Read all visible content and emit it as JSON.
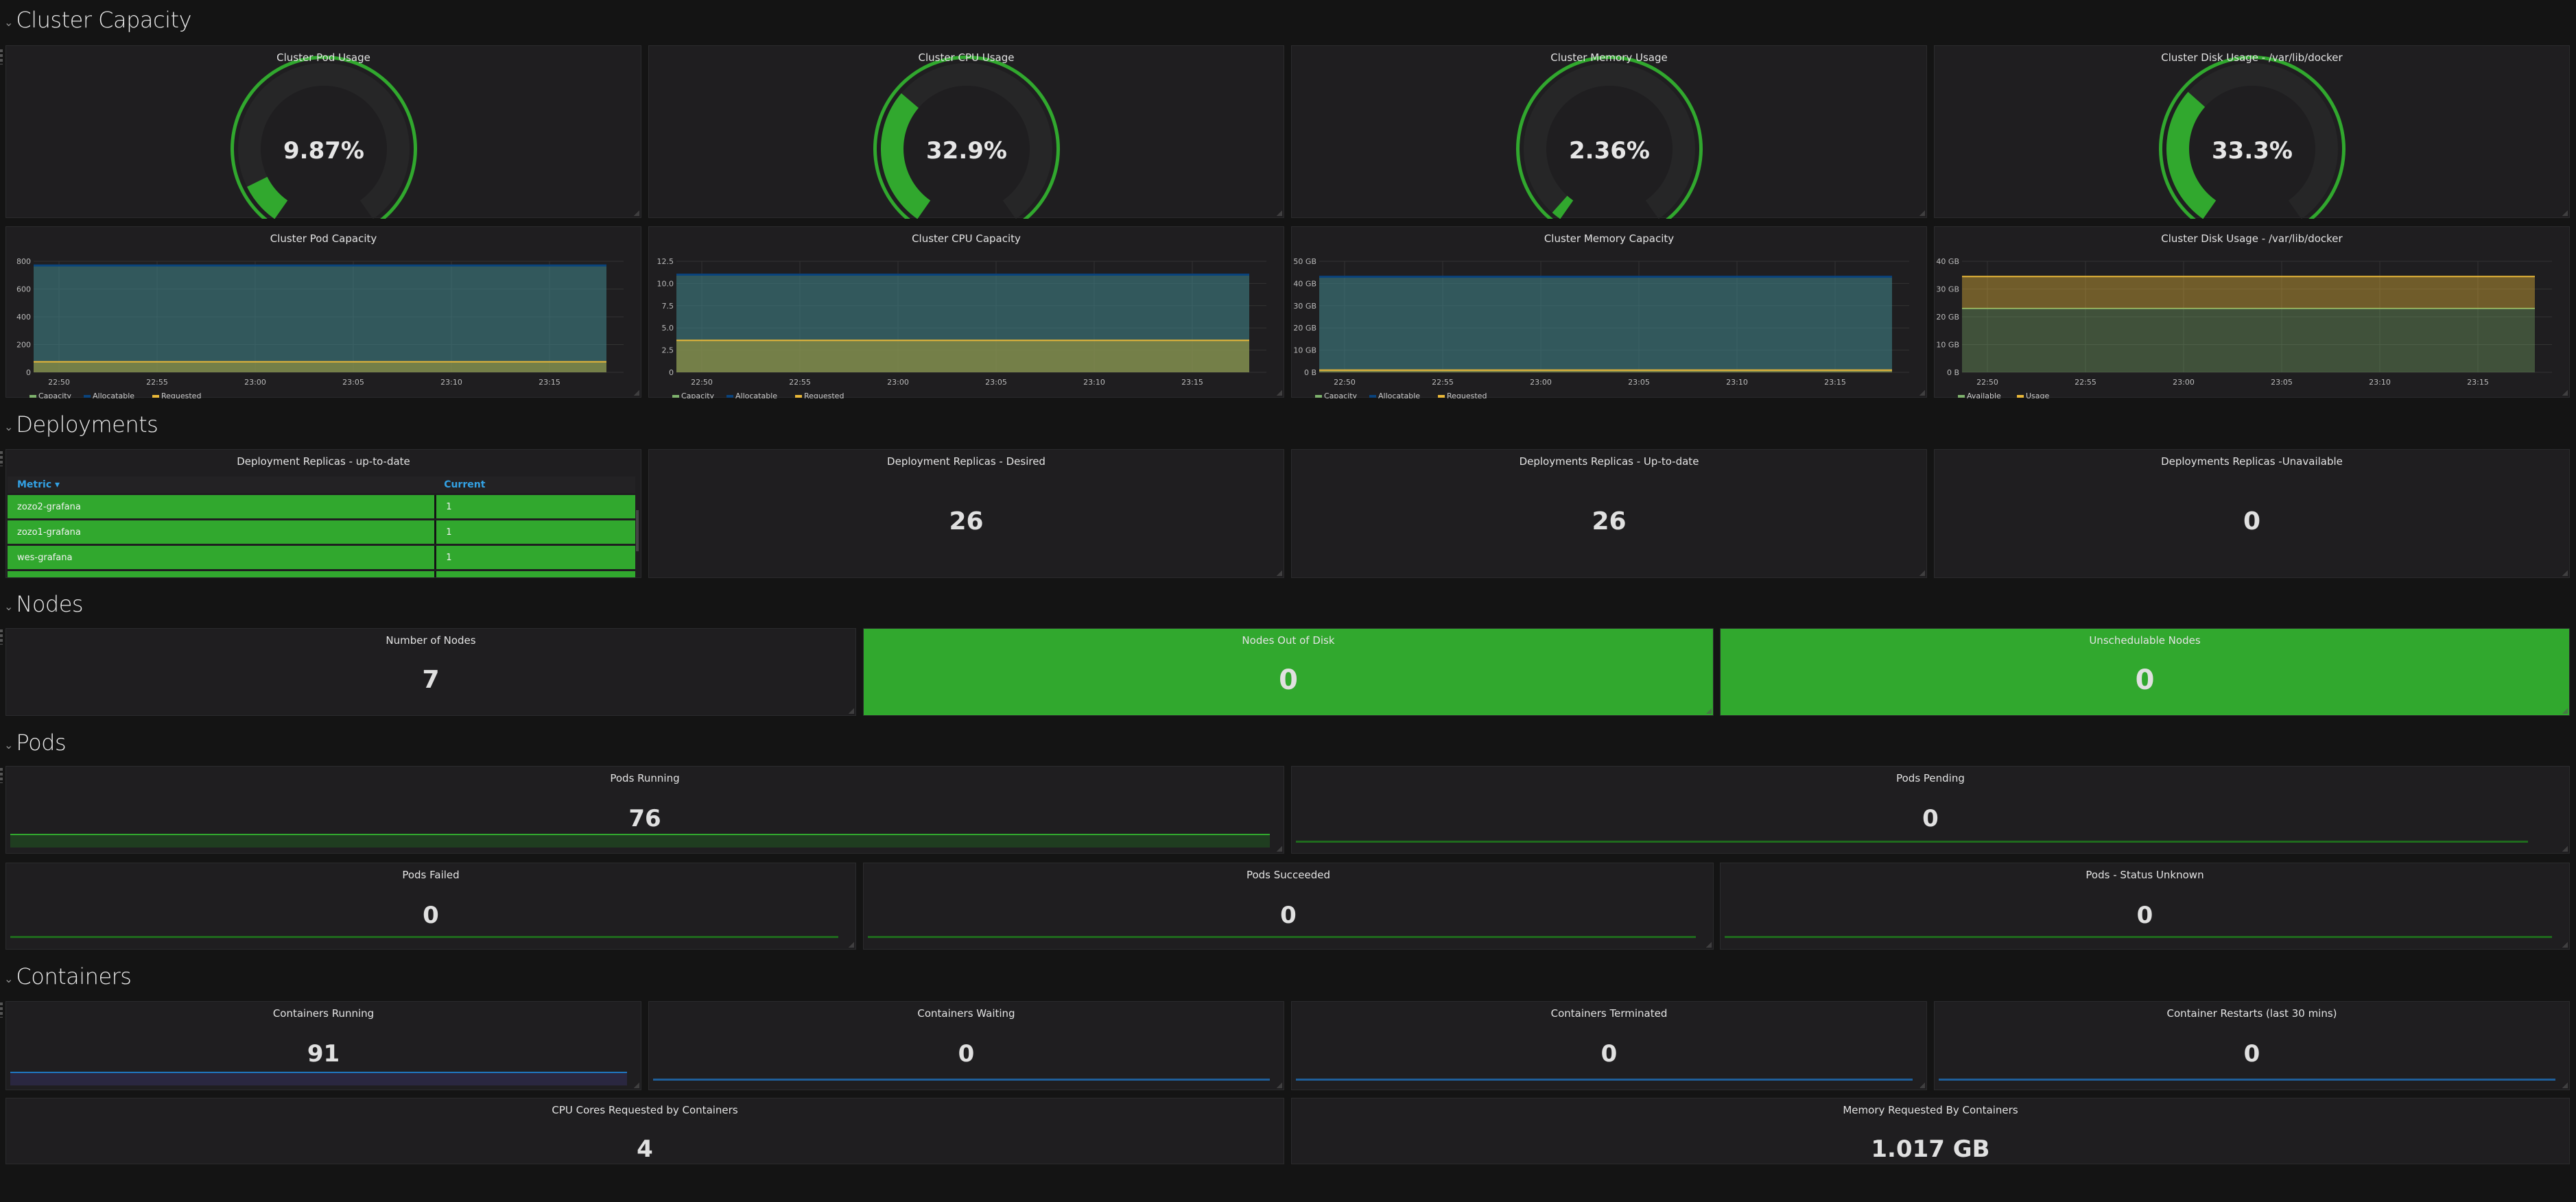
{
  "rows": {
    "cluster_capacity": "Cluster Capacity",
    "deployments": "Deployments",
    "nodes": "Nodes",
    "pods": "Pods",
    "containers": "Containers"
  },
  "colors": {
    "ok_green": "#31a82e",
    "capacity": "#7eb26d",
    "allocatable": "#0a437c",
    "requested": "#eab839",
    "blue_line": "#1f78c1"
  },
  "gauges": [
    {
      "title": "Cluster Pod Usage",
      "value_label": "9.87%",
      "percent": 9.87
    },
    {
      "title": "Cluster CPU Usage",
      "value_label": "32.9%",
      "percent": 32.9
    },
    {
      "title": "Cluster Memory Usage",
      "value_label": "2.36%",
      "percent": 2.36
    },
    {
      "title": "Cluster Disk Usage - /var/lib/docker",
      "value_label": "33.3%",
      "percent": 33.3
    }
  ],
  "chart_data": [
    {
      "type": "area",
      "title": "Cluster Pod Capacity",
      "x": [
        "22:50",
        "22:55",
        "23:00",
        "23:05",
        "23:10",
        "23:15"
      ],
      "yticks": [
        "0",
        "200",
        "400",
        "600",
        "800"
      ],
      "ylim": [
        0,
        800
      ],
      "grid": true,
      "legend": "bottom-left",
      "series": [
        {
          "name": "Capacity",
          "color": "#7eb26d",
          "value": 770
        },
        {
          "name": "Allocatable",
          "color": "#0a437c",
          "value": 770
        },
        {
          "name": "Requested",
          "color": "#eab839",
          "value": 76
        }
      ]
    },
    {
      "type": "area",
      "title": "Cluster CPU Capacity",
      "x": [
        "22:50",
        "22:55",
        "23:00",
        "23:05",
        "23:10",
        "23:15"
      ],
      "yticks": [
        "0",
        "2.5",
        "5.0",
        "7.5",
        "10.0",
        "12.5"
      ],
      "ylim": [
        0,
        12.5
      ],
      "grid": true,
      "legend": "bottom-left",
      "series": [
        {
          "name": "Capacity",
          "color": "#7eb26d",
          "value": 11
        },
        {
          "name": "Allocatable",
          "color": "#0a437c",
          "value": 11
        },
        {
          "name": "Requested",
          "color": "#eab839",
          "value": 3.6
        }
      ]
    },
    {
      "type": "area",
      "title": "Cluster Memory Capacity",
      "x": [
        "22:50",
        "22:55",
        "23:00",
        "23:05",
        "23:10",
        "23:15"
      ],
      "yticks": [
        "0 B",
        "10 GB",
        "20 GB",
        "30 GB",
        "40 GB",
        "50 GB"
      ],
      "ylim": [
        0,
        50
      ],
      "grid": true,
      "legend": "bottom-left",
      "series": [
        {
          "name": "Capacity",
          "color": "#7eb26d",
          "value": 43
        },
        {
          "name": "Allocatable",
          "color": "#0a437c",
          "value": 43
        },
        {
          "name": "Requested",
          "color": "#eab839",
          "value": 1.0
        }
      ]
    },
    {
      "type": "area",
      "title": "Cluster Disk Usage - /var/lib/docker",
      "x": [
        "22:50",
        "22:55",
        "23:00",
        "23:05",
        "23:10",
        "23:15"
      ],
      "yticks": [
        "0 B",
        "10 GB",
        "20 GB",
        "30 GB",
        "40 GB"
      ],
      "ylim": [
        0,
        40
      ],
      "grid": true,
      "legend": "bottom-left",
      "stacked": true,
      "series": [
        {
          "name": "Available",
          "color": "#7eb26d",
          "value": 23
        },
        {
          "name": "Usage",
          "color": "#eab839",
          "value": 11.5
        }
      ]
    }
  ],
  "deployments": {
    "table": {
      "title": "Deployment Replicas - up-to-date",
      "columns": [
        "Metric",
        "Current"
      ],
      "rows": [
        [
          "zozo2-grafana",
          "1"
        ],
        [
          "zozo1-grafana",
          "1"
        ],
        [
          "wes-grafana",
          "1"
        ],
        [
          "",
          ""
        ]
      ]
    },
    "stats": [
      {
        "title": "Deployment Replicas - Desired",
        "value": "26"
      },
      {
        "title": "Deployments Replicas - Up-to-date",
        "value": "26"
      },
      {
        "title": "Deployments Replicas -Unavailable",
        "value": "0"
      }
    ]
  },
  "nodes": [
    {
      "title": "Number of Nodes",
      "value": "7"
    },
    {
      "title": "Nodes Out of Disk",
      "value": "0"
    },
    {
      "title": "Unschedulable Nodes",
      "value": "0"
    }
  ],
  "pods": [
    {
      "title": "Pods Running",
      "value": "76"
    },
    {
      "title": "Pods Pending",
      "value": "0"
    },
    {
      "title": "Pods Failed",
      "value": "0"
    },
    {
      "title": "Pods Succeeded",
      "value": "0"
    },
    {
      "title": "Pods - Status Unknown",
      "value": "0"
    }
  ],
  "containers": [
    {
      "title": "Containers Running",
      "value": "91"
    },
    {
      "title": "Containers Waiting",
      "value": "0"
    },
    {
      "title": "Containers Terminated",
      "value": "0"
    },
    {
      "title": "Container Restarts (last 30 mins)",
      "value": "0"
    },
    {
      "title": "CPU Cores Requested by Containers",
      "value": "4"
    },
    {
      "title": "Memory Requested By Containers",
      "value": "1.017 GB"
    }
  ]
}
